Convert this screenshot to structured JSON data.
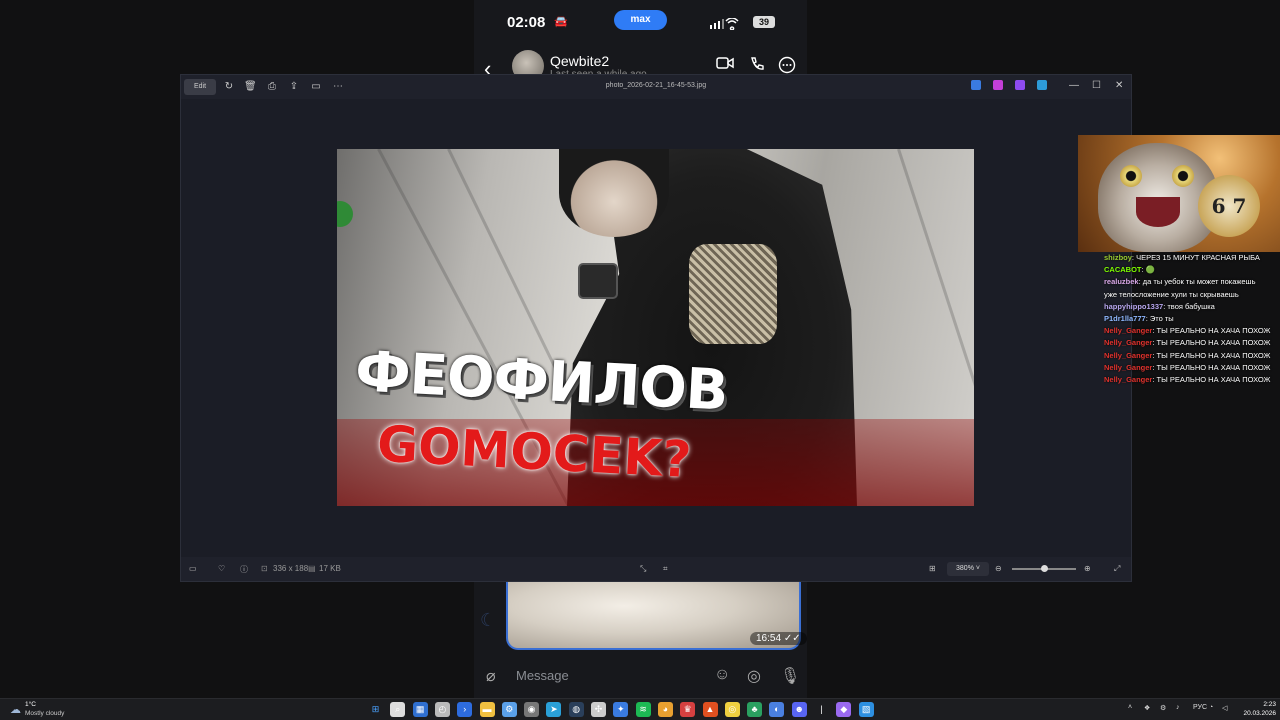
{
  "phone": {
    "time": "02:08",
    "car_icon": "car-icon",
    "app_pill": "max",
    "battery": "39",
    "contact_name": "Qewbite2",
    "last_seen": "Last seen a while ago",
    "message_time": "16:54",
    "composer_placeholder": "Message"
  },
  "viewer": {
    "edit_label": "Edit",
    "filename": "photo_2026-02-21_16-45-53.jpg",
    "dimensions": "336 x 188",
    "file_size": "17 KB",
    "zoom": "380%",
    "photo_title_line1": "ФЕОФИЛОВ",
    "photo_title_line2": "GOMOCEK?"
  },
  "stream_chat": [
    {
      "user": "shizboy",
      "message": "ЧЕРЕЗ 15 МИНУТ КРАСНАЯ РЫБА",
      "color": "#9acd32"
    },
    {
      "user": "CACABOT",
      "message": "🟢",
      "color": "#7fff00"
    },
    {
      "user": "realuzbek",
      "message": "да ты уебок ты может покажешь",
      "color": "#d9a8e8"
    },
    {
      "user": "",
      "message": "уже телосложение хули ты скрываешь",
      "color": "#ffffff"
    },
    {
      "user": "happyhippo1337",
      "message": "твоя бабушка",
      "color": "#b9a8f0"
    },
    {
      "user": "P1dr1lla777",
      "message": "Это ты",
      "color": "#8fb8ff"
    },
    {
      "user": "Nelly_Ganger",
      "message": "ТЫ РЕАЛЬНО НА ХАЧА ПОХОЖ",
      "color": "#e0322d"
    },
    {
      "user": "Nelly_Ganger",
      "message": "ТЫ РЕАЛЬНО НА ХАЧА ПОХОЖ",
      "color": "#e0322d"
    },
    {
      "user": "Nelly_Ganger",
      "message": "ТЫ РЕАЛЬНО НА ХАЧА ПОХОЖ",
      "color": "#e0322d"
    },
    {
      "user": "Nelly_Ganger",
      "message": "ТЫ РЕАЛЬНО НА ХАЧА ПОХОЖ",
      "color": "#e0322d"
    },
    {
      "user": "Nelly_Ganger",
      "message": "ТЫ РЕАЛЬНО НА ХАЧА ПОХОЖ",
      "color": "#e0322d"
    }
  ],
  "cam": {
    "watch_text": "6 7"
  },
  "taskbar": {
    "temperature": "1°C",
    "weather": "Mostly cloudy",
    "language": "РУС",
    "time": "2:23",
    "date": "20.03.2026",
    "apps": [
      "start-icon",
      "search-icon",
      "widgets-icon",
      "task-manager-icon",
      "terminal-icon",
      "file-explorer-icon",
      "settings-icon",
      "obs-icon",
      "telegram-icon",
      "steam-icon",
      "chatgpt-icon",
      "photos-icon",
      "spotify-icon",
      "chrome-icon",
      "game-icon",
      "brave-icon",
      "coin-icon",
      "app-icon",
      "browser-icon",
      "discord-icon",
      "divider",
      "notes-icon",
      "photos-viewer-icon"
    ]
  }
}
